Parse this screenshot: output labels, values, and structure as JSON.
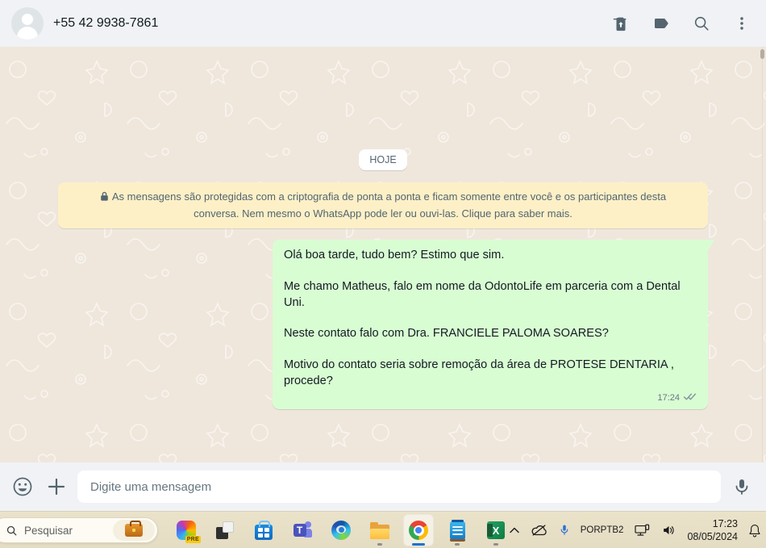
{
  "header": {
    "contact_name": "+55 42 9938-7861",
    "icons": {
      "delete": "delete-icon",
      "label": "label-icon",
      "search": "search-icon",
      "menu": "kebab-menu-icon"
    }
  },
  "chat": {
    "date_chip": "HOJE",
    "encryption_notice": "As mensagens são protegidas com a criptografia de ponta a ponta e ficam somente entre você e os participantes desta conversa. Nem mesmo o WhatsApp pode ler ou ouvi-las. Clique para saber mais.",
    "messages": [
      {
        "direction": "outgoing",
        "paragraphs": [
          "Olá boa tarde, tudo bem? Estimo que sim.",
          "Me chamo Matheus, falo em nome da OdontoLife em parceria com a Dental Uni.",
          "Neste contato falo com Dra. FRANCIELE PALOMA SOARES?",
          "Motivo do contato seria sobre remoção da área de PROTESE DENTARIA , procede?"
        ],
        "time": "17:24",
        "status": "delivered"
      }
    ]
  },
  "composer": {
    "placeholder": "Digite uma mensagem"
  },
  "taskbar": {
    "search_placeholder": "Pesquisar",
    "copilot_badge": "PRE",
    "teams_letter": "T",
    "excel_letter": "X",
    "language": {
      "line1": "POR",
      "line2": "PTB2"
    },
    "clock": {
      "time": "17:23",
      "date": "08/05/2024"
    }
  },
  "colors": {
    "header_bg": "#f0f2f5",
    "chat_bg": "#efe7dc",
    "banner_bg": "#fdf0c7",
    "bubble_green": "#d9fdd3",
    "icon_gray": "#54656f",
    "text_primary": "#111b21",
    "text_secondary": "#667781",
    "taskbar_beige": "#e7dfc6",
    "active_indicator_blue": "#1974d2"
  }
}
